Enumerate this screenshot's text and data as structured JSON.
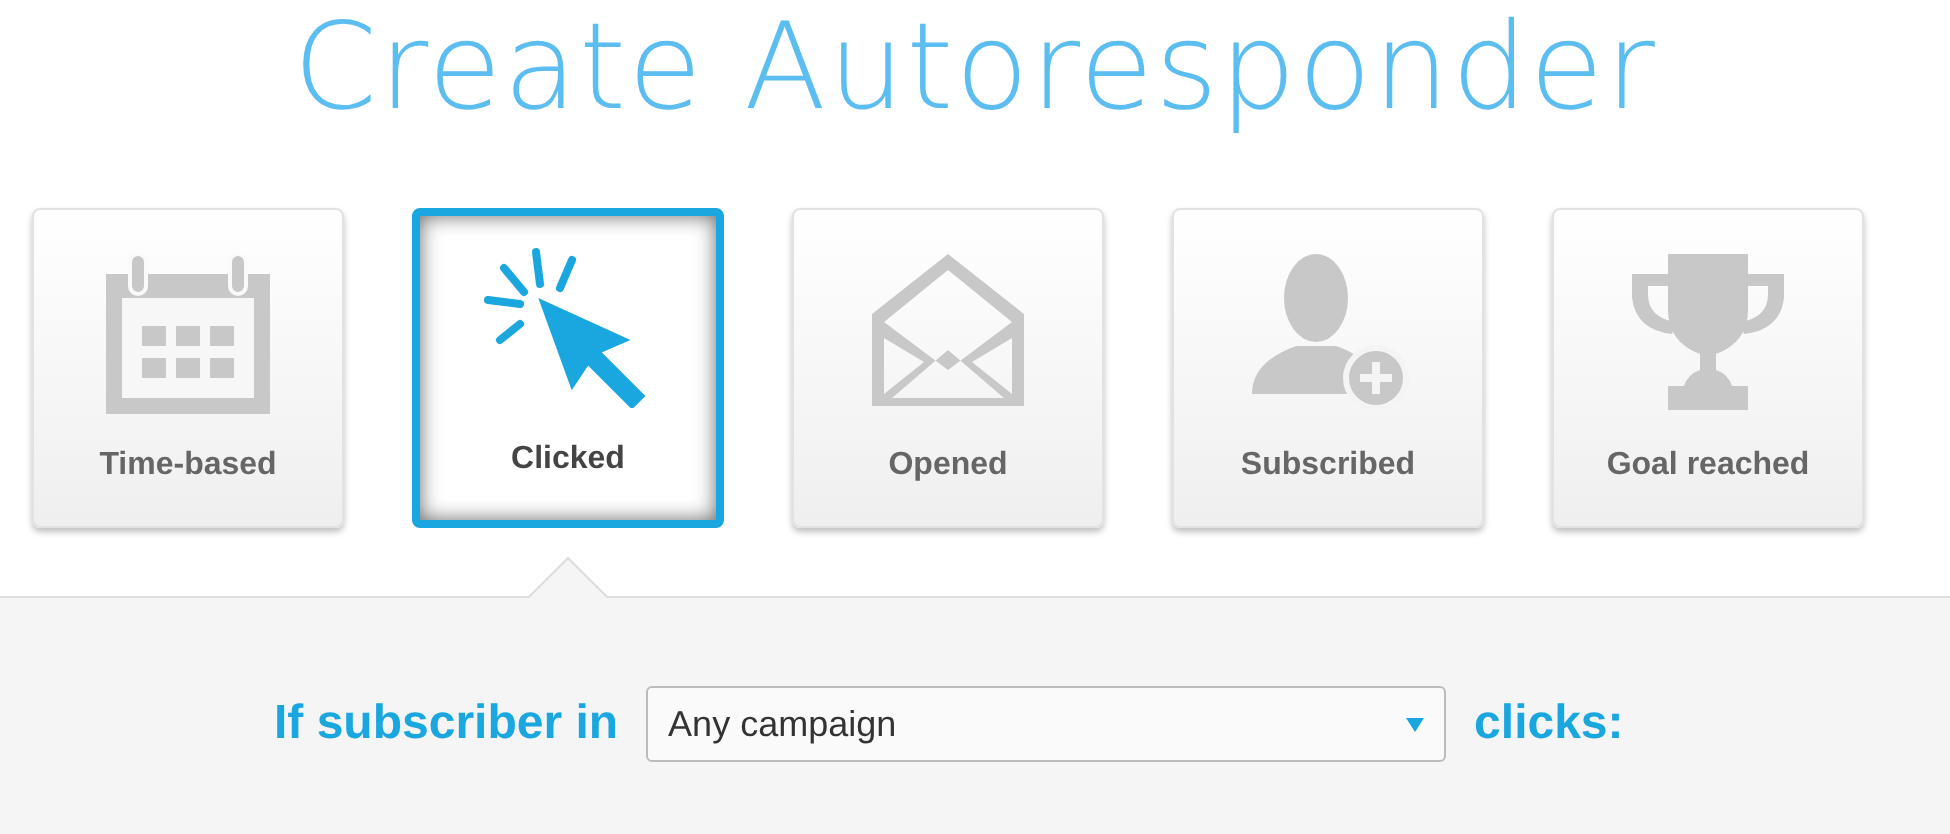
{
  "title": "Create Autoresponder",
  "triggers": [
    {
      "label": "Time-based",
      "kind": "calendar",
      "selected": false
    },
    {
      "label": "Clicked",
      "kind": "click",
      "selected": true
    },
    {
      "label": "Opened",
      "kind": "envelope",
      "selected": false
    },
    {
      "label": "Subscribed",
      "kind": "user",
      "selected": false
    },
    {
      "label": "Goal reached",
      "kind": "trophy",
      "selected": false
    }
  ],
  "condition": {
    "prefix": "If subscriber in",
    "campaign": "Any campaign",
    "suffix": "clicks:"
  }
}
